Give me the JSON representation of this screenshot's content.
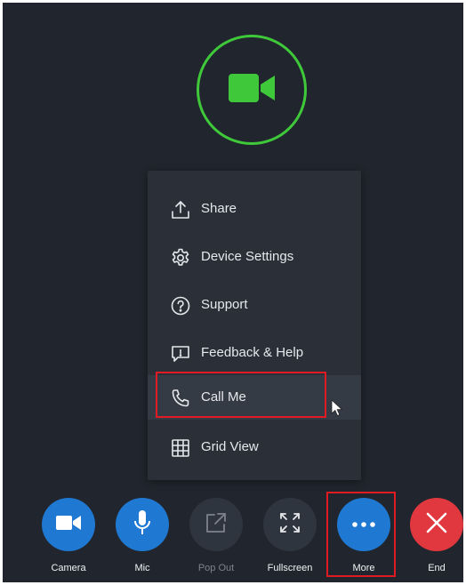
{
  "menu": {
    "items": [
      {
        "label": "Share",
        "icon": "share-upload-icon"
      },
      {
        "label": "Device Settings",
        "icon": "gear-icon"
      },
      {
        "label": "Support",
        "icon": "question-circle-icon"
      },
      {
        "label": "Feedback & Help",
        "icon": "feedback-bubble-icon"
      },
      {
        "label": "Call Me",
        "icon": "phone-icon",
        "state": "hovered, highlighted"
      },
      {
        "label": "Grid View",
        "icon": "grid-icon"
      }
    ]
  },
  "controls": [
    {
      "label": "Camera",
      "icon": "video-camera-icon",
      "color": "#1f78d1"
    },
    {
      "label": "Mic",
      "icon": "microphone-icon",
      "color": "#1f78d1"
    },
    {
      "label": "Pop Out",
      "icon": "pop-out-icon",
      "color": "#2f353e",
      "state": "disabled"
    },
    {
      "label": "Fullscreen",
      "icon": "fullscreen-icon",
      "color": "#2f353e"
    },
    {
      "label": "More",
      "icon": "more-dots-icon",
      "color": "#1f78d1",
      "state": "active, highlighted"
    },
    {
      "label": "End",
      "icon": "close-x-icon",
      "color": "#e0383e"
    }
  ],
  "colors": {
    "background": "#21262e",
    "menu_background": "#2a2f38",
    "accent_green": "#3fc93a",
    "accent_blue": "#1f78d1",
    "end_red": "#e0383e",
    "highlight_red": "#e01b24"
  }
}
